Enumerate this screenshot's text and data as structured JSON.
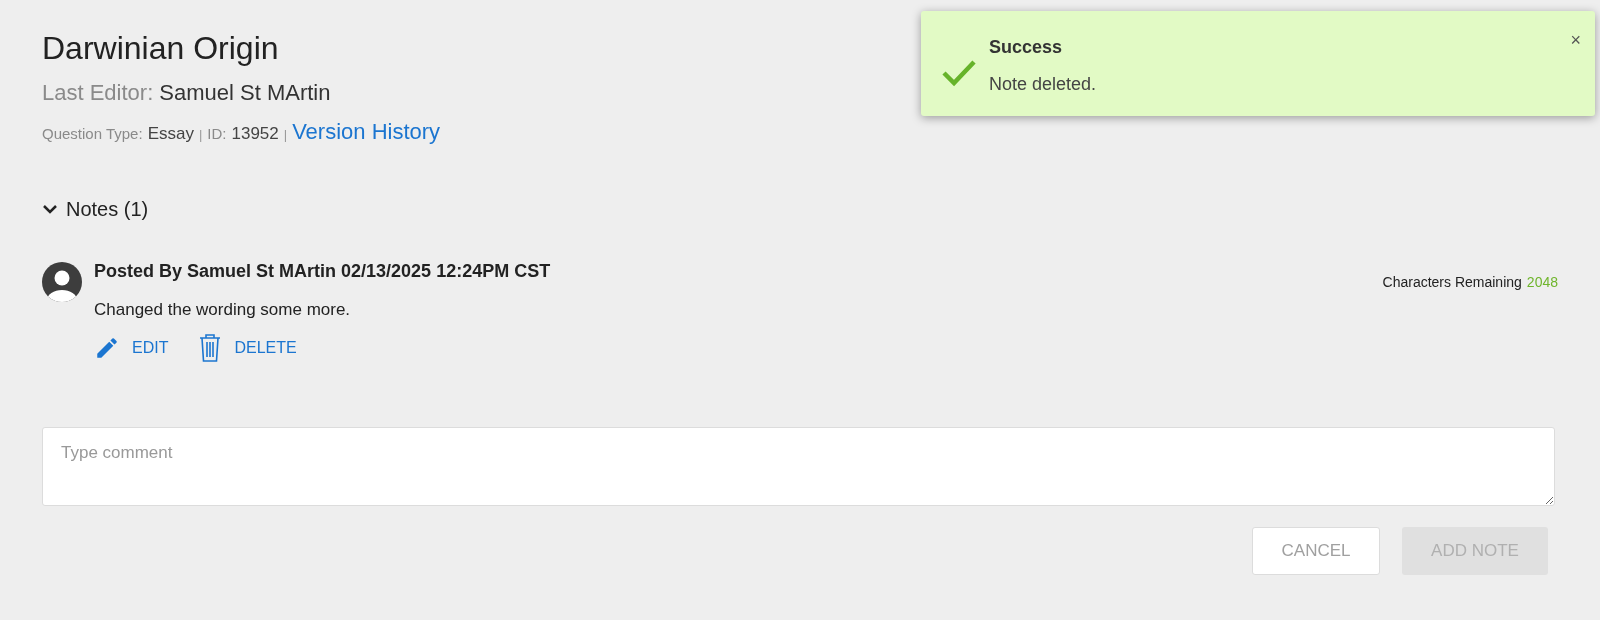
{
  "header": {
    "title": "Darwinian Origin",
    "last_editor_label": "Last Editor:",
    "last_editor": "Samuel St MArtin",
    "question_type_label": "Question Type:",
    "question_type": "Essay",
    "separator_1": "|",
    "id_label": "ID:",
    "id": "13952",
    "separator_2": "|",
    "version_history_link": "Version History"
  },
  "notes_section": {
    "label": "Notes (1)",
    "expanded": true,
    "notes": [
      {
        "posted_by": "Posted By Samuel St MArtin 02/13/2025 12:24PM CST",
        "text": "Changed the wording some more.",
        "actions": [
          {
            "kind": "edit",
            "label": "EDIT"
          },
          {
            "kind": "delete",
            "label": "DELETE"
          }
        ]
      }
    ],
    "characters_remaining_label": "Characters Remaining",
    "characters_remaining": "2048",
    "comment_field": {
      "placeholder": "Type comment"
    },
    "buttons": [
      {
        "label": "CANCEL",
        "disabled": false
      },
      {
        "label": "ADD NOTE",
        "disabled": true
      }
    ]
  },
  "toast": {
    "title": "Success",
    "message": "Note deleted.",
    "close": "×"
  }
}
